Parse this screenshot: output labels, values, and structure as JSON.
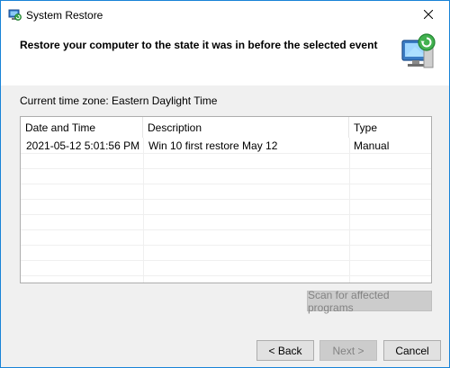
{
  "window": {
    "title": "System Restore"
  },
  "header": {
    "heading": "Restore your computer to the state it was in before the selected event"
  },
  "timezone_label": "Current time zone: Eastern Daylight Time",
  "table": {
    "columns": [
      "Date and Time",
      "Description",
      "Type"
    ],
    "rows": [
      {
        "date_time": "2021-05-12 5:01:56 PM",
        "description": "Win 10 first restore May 12",
        "type": "Manual"
      }
    ]
  },
  "buttons": {
    "scan": "Scan for affected programs",
    "back": "< Back",
    "next": "Next >",
    "cancel": "Cancel"
  },
  "icons": {
    "app": "system-restore-icon",
    "header": "system-restore-computer-icon",
    "close": "close-icon"
  },
  "colors": {
    "window_border": "#1883d7",
    "button_focus_border": "#0078d7"
  }
}
